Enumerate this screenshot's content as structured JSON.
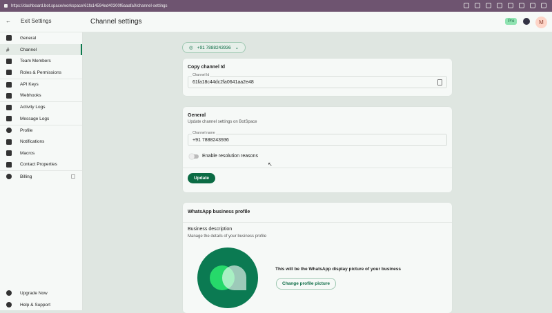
{
  "browser": {
    "url": "https://dashboard.bot.space/workspace/61fa14594ed40300f6aaafa0/channel-settings"
  },
  "header": {
    "exit": "Exit Settings",
    "title": "Channel settings",
    "badge": "Pro",
    "avatar": "M"
  },
  "sidebar": {
    "items": [
      {
        "label": "General",
        "icon": "briefcase-icon"
      },
      {
        "label": "Channel",
        "icon": "hash-icon"
      },
      {
        "label": "Team Members",
        "icon": "team-icon"
      },
      {
        "label": "Roles & Permissions",
        "icon": "lock-icon"
      },
      {
        "label": "API Keys",
        "icon": "api-icon"
      },
      {
        "label": "Webhooks",
        "icon": "webhook-icon"
      },
      {
        "label": "Activity Logs",
        "icon": "list-icon"
      },
      {
        "label": "Message Logs",
        "icon": "log-icon"
      },
      {
        "label": "Profile",
        "icon": "user-icon"
      },
      {
        "label": "Notifications",
        "icon": "bell-icon"
      },
      {
        "label": "Macros",
        "icon": "bookmark-icon"
      },
      {
        "label": "Contact Properties",
        "icon": "contact-icon"
      },
      {
        "label": "Billing",
        "icon": "dollar-icon"
      }
    ],
    "bottom": [
      {
        "label": "Upgrade Now"
      },
      {
        "label": "Help & Support"
      }
    ]
  },
  "channel_select": "+91 7888243936",
  "copy_card": {
    "title": "Copy channel Id",
    "label": "Channel Id",
    "value": "61fa18c44dc2fa0641aa2e48"
  },
  "general_card": {
    "title": "General",
    "subtitle": "Update channel settings on BotSpace",
    "label": "Channel name",
    "value": "+91 7888243936",
    "toggle": "Enable resolution reasons",
    "toggle_on": false,
    "button": "Update"
  },
  "profile_card": {
    "title": "WhatsApp business profile",
    "section": "Business description",
    "subtitle": "Manage the details of your business profile",
    "pic_text": "This will be the WhatsApp display picture of your business",
    "button": "Change profile picture"
  }
}
